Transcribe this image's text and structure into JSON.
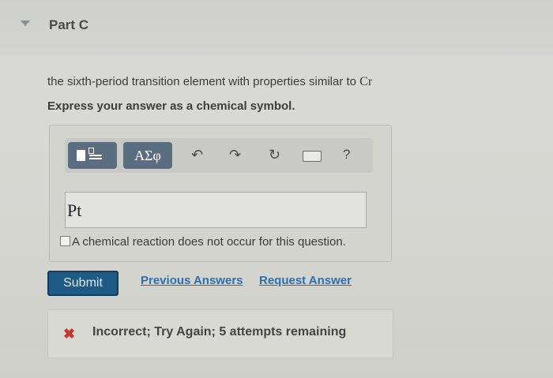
{
  "part": {
    "title": "Part C",
    "collapse_icon": "caret-down-icon"
  },
  "question": {
    "text": "the sixth-period transition element with properties similar to ",
    "symbol": "Cr"
  },
  "instruction": "Express your answer as a chemical symbol.",
  "toolbar": {
    "template_icon": "template-icon",
    "greek_label": "ΑΣφ",
    "undo_icon": "↶",
    "redo_icon": "↷",
    "reset_icon": "↻",
    "keyboard_icon": "keyboard-icon",
    "help_label": "?"
  },
  "answer": {
    "value": "Pt"
  },
  "no_reaction": {
    "label": "A chemical reaction does not occur for this question.",
    "checked": false
  },
  "actions": {
    "submit_label": "Submit",
    "previous_answers_label": "Previous Answers",
    "request_answer_label": "Request Answer"
  },
  "feedback": {
    "icon": "✖",
    "text": "Incorrect; Try Again; 5 attempts remaining",
    "color": "#c0392b"
  }
}
